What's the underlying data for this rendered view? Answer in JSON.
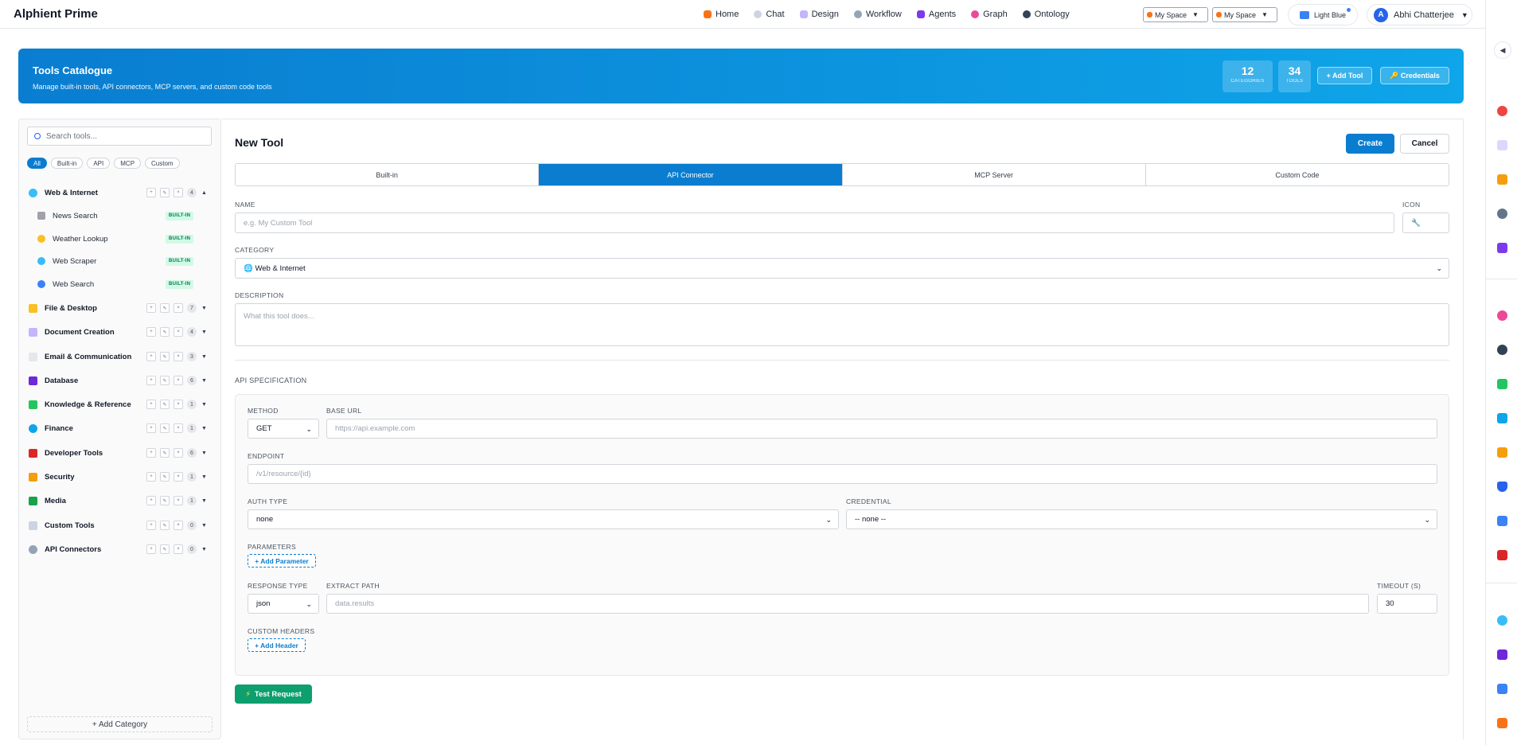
{
  "app": {
    "title": "Alphient Prime"
  },
  "nav": [
    {
      "label": "Home",
      "icon": "home-icon",
      "color": "#f97316"
    },
    {
      "label": "Chat",
      "icon": "chat-icon",
      "color": "#94a3b8"
    },
    {
      "label": "Design",
      "icon": "document-icon",
      "color": "#a78bfa"
    },
    {
      "label": "Workflow",
      "icon": "gear-icon",
      "color": "#64748b"
    },
    {
      "label": "Agents",
      "icon": "robot-icon",
      "color": "#7c3aed"
    },
    {
      "label": "Graph",
      "icon": "brain-icon",
      "color": "#ec4899"
    },
    {
      "label": "Ontology",
      "icon": "globe-icon",
      "color": "#0ea5e9"
    }
  ],
  "space_selects": [
    "My Space",
    "My Space"
  ],
  "theme": {
    "label": "Light Blue"
  },
  "user": {
    "initial": "A",
    "name": "Abhi Chatterjee"
  },
  "hero": {
    "title": "Tools Catalogue",
    "subtitle": "Manage built-in tools, API connectors, MCP servers, and custom code tools",
    "stats": [
      {
        "value": "12",
        "label": "CATEGORIES"
      },
      {
        "value": "34",
        "label": "TOOLS"
      }
    ],
    "add_tool_label": "+ Add Tool",
    "credentials_label": "🔑 Credentials"
  },
  "sidebar": {
    "search_placeholder": "Search tools...",
    "filters": [
      "All",
      "Built-in",
      "API",
      "MCP",
      "Custom"
    ],
    "active_filter": "All",
    "categories": [
      {
        "label": "Web & Internet",
        "count": "4",
        "expanded": true,
        "icon": "globe-icon",
        "color": "#38bdf8",
        "tools": [
          {
            "label": "News Search",
            "badge": "BUILT-IN",
            "icon": "newspaper-icon",
            "color": "#a1a1aa"
          },
          {
            "label": "Weather Lookup",
            "badge": "BUILT-IN",
            "icon": "weather-icon",
            "color": "#fbbf24"
          },
          {
            "label": "Web Scraper",
            "badge": "BUILT-IN",
            "icon": "globe-icon",
            "color": "#38bdf8"
          },
          {
            "label": "Web Search",
            "badge": "BUILT-IN",
            "icon": "magnifier-icon",
            "color": "#3b82f6"
          }
        ]
      },
      {
        "label": "File & Desktop",
        "count": "7",
        "icon": "folder-icon",
        "color": "#fbbf24"
      },
      {
        "label": "Document Creation",
        "count": "4",
        "icon": "document-icon",
        "color": "#c4b5fd"
      },
      {
        "label": "Email & Communication",
        "count": "3",
        "icon": "envelope-icon",
        "color": "#e5e7eb"
      },
      {
        "label": "Database",
        "count": "6",
        "icon": "database-icon",
        "color": "#6d28d9"
      },
      {
        "label": "Knowledge & Reference",
        "count": "1",
        "icon": "books-icon",
        "color": "#22c55e"
      },
      {
        "label": "Finance",
        "count": "1",
        "icon": "exchange-icon",
        "color": "#0ea5e9"
      },
      {
        "label": "Developer Tools",
        "count": "6",
        "icon": "tools-icon",
        "color": "#dc2626"
      },
      {
        "label": "Security",
        "count": "1",
        "icon": "lock-icon",
        "color": "#f59e0b"
      },
      {
        "label": "Media",
        "count": "1",
        "icon": "picture-icon",
        "color": "#16a34a"
      },
      {
        "label": "Custom Tools",
        "count": "0",
        "icon": "wrench-icon",
        "color": "#94a3b8"
      },
      {
        "label": "API Connectors",
        "count": "0",
        "icon": "link-icon",
        "color": "#94a3b8"
      }
    ],
    "add_category_label": "+ Add Category"
  },
  "form": {
    "title": "New Tool",
    "create_label": "Create",
    "cancel_label": "Cancel",
    "tabs": [
      "Built-in",
      "API Connector",
      "MCP Server",
      "Custom Code"
    ],
    "active_tab": "API Connector",
    "name_label": "NAME",
    "name_placeholder": "e.g. My Custom Tool",
    "icon_label": "ICON",
    "icon_placeholder": "🔧",
    "category_label": "CATEGORY",
    "category_value": "🌐 Web & Internet",
    "description_label": "DESCRIPTION",
    "description_placeholder": "What this tool does...",
    "api_section_title": "API SPECIFICATION",
    "method_label": "METHOD",
    "method_value": "GET",
    "base_url_label": "BASE URL",
    "base_url_placeholder": "https://api.example.com",
    "endpoint_label": "ENDPOINT",
    "endpoint_placeholder": "/v1/resource/{id}",
    "auth_type_label": "AUTH TYPE",
    "auth_type_value": "none",
    "credential_label": "CREDENTIAL",
    "credential_value": "-- none --",
    "parameters_label": "PARAMETERS",
    "add_parameter_label": "+ Add Parameter",
    "response_type_label": "RESPONSE TYPE",
    "response_type_value": "json",
    "extract_path_label": "EXTRACT PATH",
    "extract_path_placeholder": "data.results",
    "timeout_label": "TIMEOUT (S)",
    "timeout_value": "30",
    "custom_headers_label": "CUSTOM HEADERS",
    "add_header_label": "+ Add Header",
    "test_request_label": "Test Request"
  },
  "rail_icons": [
    "target-icon",
    "document-icon",
    "clipboard-icon",
    "gear-icon",
    "robot-icon",
    "brain-icon",
    "globe-icon",
    "books-icon",
    "book-icon",
    "clipboard-icon",
    "shield-icon",
    "bag-icon",
    "tools-icon",
    "globe-icon",
    "database-icon",
    "chart-icon",
    "scale-icon"
  ]
}
